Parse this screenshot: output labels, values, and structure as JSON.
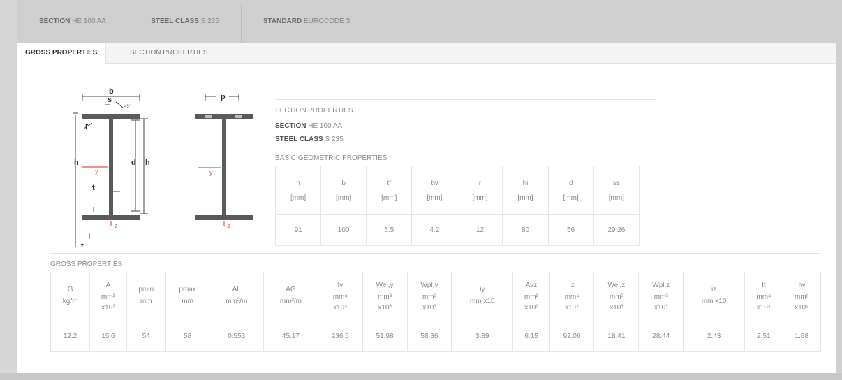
{
  "top_tabs": [
    {
      "prefix": "SECTION",
      "value": "HE 100 AA"
    },
    {
      "prefix": "STEEL CLASS",
      "value": "S 235"
    },
    {
      "prefix": "STANDARD",
      "value": "EUROCODE 3"
    }
  ],
  "sub_tabs": [
    "GROSS PROPERTIES",
    "SECTION PROPERTIES"
  ],
  "diagram_labels": {
    "b": "b",
    "ss": "s",
    "ss_sub": "s",
    "angle": "45°",
    "r": "r",
    "h": "h",
    "d": "d",
    "hi": "h",
    "hi_sub": "i",
    "y": "y",
    "tw": "t",
    "tw_sub": "w",
    "tf": "t",
    "tf_sub": "f",
    "z": "z",
    "p": "p"
  },
  "section_info": {
    "title": "SECTION PROPERTIES",
    "section_label": "SECTION",
    "section_value": "HE 100 AA",
    "steel_label": "STEEL CLASS",
    "steel_value": "S 235",
    "basic_title": "BASIC GEOMETRIC PROPERTIES"
  },
  "basic_table": {
    "symbols": [
      "h",
      "b",
      "tf",
      "tw",
      "r",
      "hi",
      "d",
      "ss"
    ],
    "units": [
      "[mm]",
      "[mm]",
      "[mm]",
      "[mm]",
      "[mm]",
      "[mm]",
      "[mm]",
      "[mm]"
    ],
    "values": [
      "91",
      "100",
      "5.5",
      "4.2",
      "12",
      "80",
      "56",
      "29.26"
    ]
  },
  "gross": {
    "title": "GROSS PROPERTIES",
    "columns": [
      {
        "sym": "G",
        "u1": "kg/m",
        "u2": "",
        "val": "12.2"
      },
      {
        "sym": "A",
        "u1": "mm²",
        "u2": "x10²",
        "val": "15.6"
      },
      {
        "sym": "pmin",
        "u1": "mm",
        "u2": "",
        "val": "54"
      },
      {
        "sym": "pmax",
        "u1": "mm",
        "u2": "",
        "val": "58"
      },
      {
        "sym": "AL",
        "u1": "mm²/m",
        "u2": "",
        "val": "0.553"
      },
      {
        "sym": "AG",
        "u1": "mm²/m",
        "u2": "",
        "val": "45.17"
      },
      {
        "sym": "Iy",
        "u1": "mm⁴",
        "u2": "x10⁴",
        "val": "236.5"
      },
      {
        "sym": "Wel,y",
        "u1": "mm³",
        "u2": "x10³",
        "val": "51.98"
      },
      {
        "sym": "Wpl,y",
        "u1": "mm³",
        "u2": "x10³",
        "val": "58.36"
      },
      {
        "sym": "iy",
        "u1": "mm x10",
        "u2": "",
        "val": "3.89"
      },
      {
        "sym": "Avz",
        "u1": "mm²",
        "u2": "x10²",
        "val": "6.15"
      },
      {
        "sym": "Iz",
        "u1": "mm⁴",
        "u2": "x10⁴",
        "val": "92.06"
      },
      {
        "sym": "Wel,z",
        "u1": "mm³",
        "u2": "x10³",
        "val": "18.41"
      },
      {
        "sym": "Wpl,z",
        "u1": "mm³",
        "u2": "x10³",
        "val": "28.44"
      },
      {
        "sym": "iz",
        "u1": "mm x10",
        "u2": "",
        "val": "2.43"
      },
      {
        "sym": "It",
        "u1": "mm⁴",
        "u2": "x10⁴",
        "val": "2.51"
      },
      {
        "sym": "Iw",
        "u1": "mm⁶",
        "u2": "x10⁹",
        "val": "1.68"
      }
    ]
  },
  "colors": {
    "axis_red": "#e8553a",
    "steel": "#555555"
  }
}
